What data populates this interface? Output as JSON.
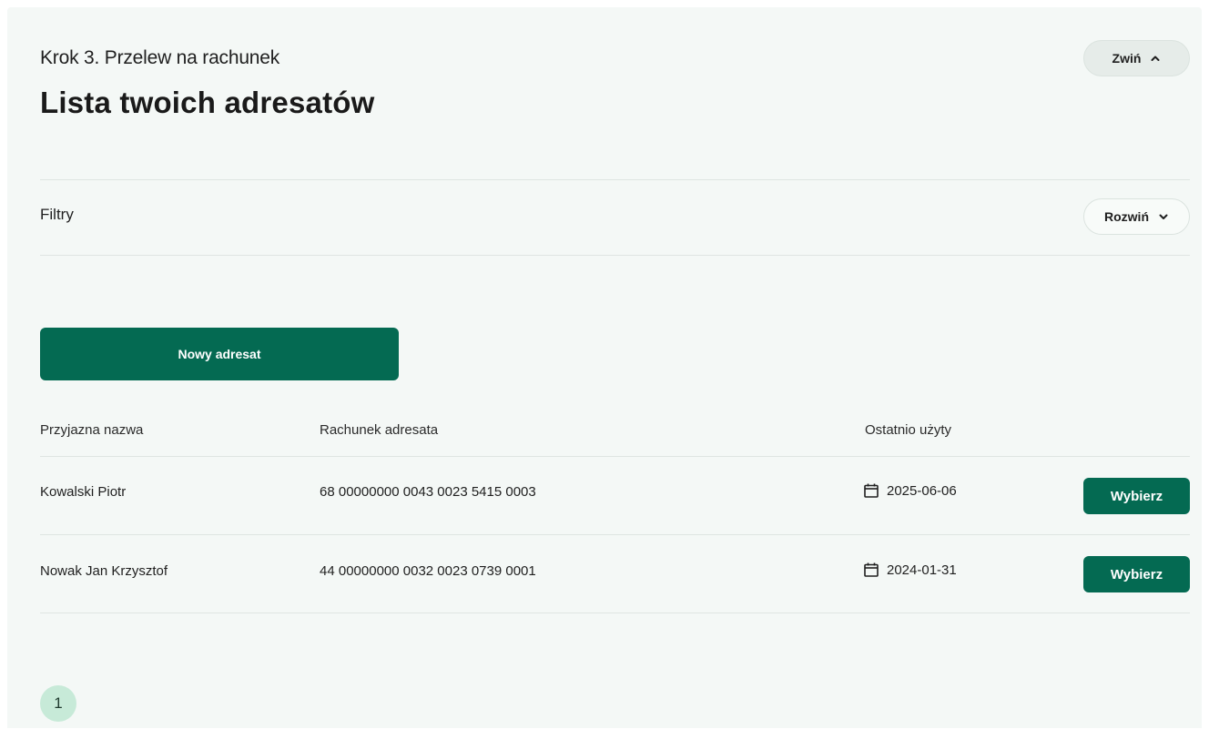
{
  "header": {
    "step_label": "Krok 3. Przelew na rachunek",
    "title": "Lista twoich adresatów",
    "collapse_label": "Zwiń"
  },
  "filters": {
    "label": "Filtry",
    "expand_label": "Rozwiń"
  },
  "actions": {
    "new_recipient_label": "Nowy adresat"
  },
  "table": {
    "columns": [
      "Przyjazna nazwa",
      "Rachunek adresata",
      "Ostatnio użyty"
    ],
    "rows": [
      {
        "name": "Kowalski Piotr",
        "account": "68 00000000 0043 0023 5415 0003",
        "last_used": "2025-06-06",
        "action_label": "Wybierz"
      },
      {
        "name": "Nowak Jan Krzysztof",
        "account": "44 00000000 0032 0023 0739 0001",
        "last_used": "2024-01-31",
        "action_label": "Wybierz"
      }
    ]
  },
  "pagination": {
    "current_page": "1"
  },
  "colors": {
    "primary": "#046a52",
    "panel_bg": "#f4f8f6",
    "page_active_bg": "#c7ead8"
  }
}
